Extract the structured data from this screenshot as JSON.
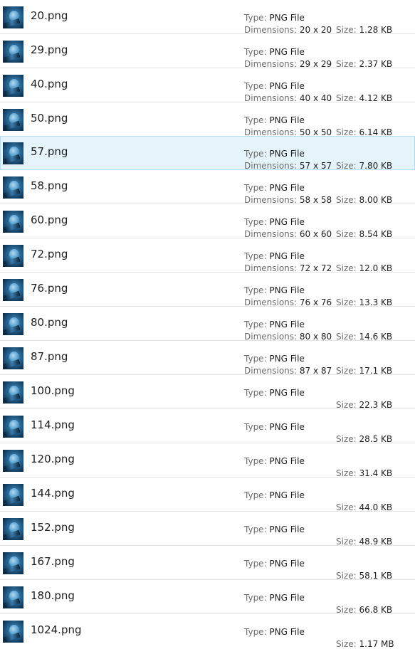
{
  "labels": {
    "type": "Type: ",
    "dimensions": "Dimensions: ",
    "size": "Size: "
  },
  "files": [
    {
      "name": "20.png",
      "type": "PNG File",
      "dimensions": "20 x 20",
      "size": "1.28 KB"
    },
    {
      "name": "29.png",
      "type": "PNG File",
      "dimensions": "29 x 29",
      "size": "2.37 KB"
    },
    {
      "name": "40.png",
      "type": "PNG File",
      "dimensions": "40 x 40",
      "size": "4.12 KB"
    },
    {
      "name": "50.png",
      "type": "PNG File",
      "dimensions": "50 x 50",
      "size": "6.14 KB"
    },
    {
      "name": "57.png",
      "type": "PNG File",
      "dimensions": "57 x 57",
      "size": "7.80 KB",
      "selected": true
    },
    {
      "name": "58.png",
      "type": "PNG File",
      "dimensions": "58 x 58",
      "size": "8.00 KB"
    },
    {
      "name": "60.png",
      "type": "PNG File",
      "dimensions": "60 x 60",
      "size": "8.54 KB"
    },
    {
      "name": "72.png",
      "type": "PNG File",
      "dimensions": "72 x 72",
      "size": "12.0 KB"
    },
    {
      "name": "76.png",
      "type": "PNG File",
      "dimensions": "76 x 76",
      "size": "13.3 KB"
    },
    {
      "name": "80.png",
      "type": "PNG File",
      "dimensions": "80 x 80",
      "size": "14.6 KB"
    },
    {
      "name": "87.png",
      "type": "PNG File",
      "dimensions": "87 x 87",
      "size": "17.1 KB"
    },
    {
      "name": "100.png",
      "type": "PNG File",
      "size": "22.3 KB"
    },
    {
      "name": "114.png",
      "type": "PNG File",
      "size": "28.5 KB"
    },
    {
      "name": "120.png",
      "type": "PNG File",
      "size": "31.4 KB"
    },
    {
      "name": "144.png",
      "type": "PNG File",
      "size": "44.0 KB"
    },
    {
      "name": "152.png",
      "type": "PNG File",
      "size": "48.9 KB"
    },
    {
      "name": "167.png",
      "type": "PNG File",
      "size": "58.1 KB"
    },
    {
      "name": "180.png",
      "type": "PNG File",
      "size": "66.8 KB"
    },
    {
      "name": "1024.png",
      "type": "PNG File",
      "size": "1.17 MB"
    }
  ],
  "colors": {
    "selected_bg": "#e5f3fb",
    "selected_border": "#b7def5",
    "row_divider": "#e3e3e3"
  }
}
